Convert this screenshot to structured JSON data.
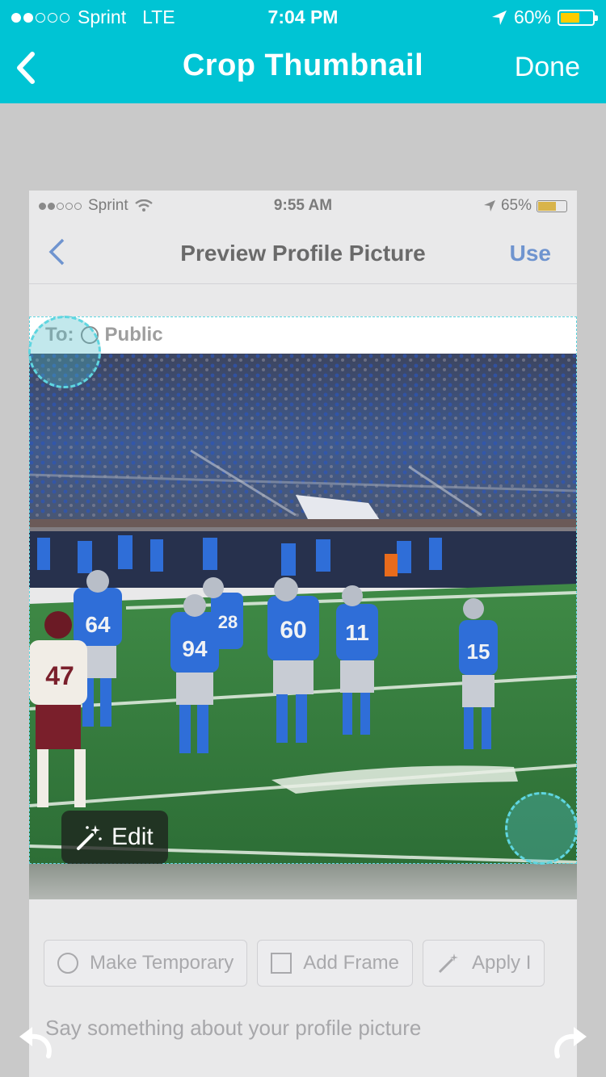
{
  "status_bar": {
    "carrier": "Sprint",
    "network": "LTE",
    "time": "7:04 PM",
    "battery": "60%",
    "battery_level": 0.6,
    "signal_bars": 2
  },
  "nav": {
    "title": "Crop Thumbnail",
    "done_label": "Done"
  },
  "embedded_screenshot": {
    "status": {
      "carrier": "Sprint",
      "time": "9:55 AM",
      "battery": "65%"
    },
    "title": "Preview Profile Picture",
    "use_label": "Use",
    "to_label": "To:",
    "audience": "Public",
    "actions": [
      "Make Temporary",
      "Add Frame",
      "Apply I"
    ],
    "caption_placeholder": "Say something about your profile picture"
  },
  "photo": {
    "jersey_numbers": [
      "64",
      "94",
      "60",
      "11",
      "15",
      "47",
      "28"
    ]
  },
  "edit_button": {
    "label": "Edit"
  },
  "colors": {
    "accent": "#00c4d4",
    "crop_outline": "#5fd6e0",
    "battery_fill": "#ffcc00",
    "lions_blue": "#2f6ed8",
    "field_green": "#2e7a3a"
  },
  "icons": {
    "back": "chevron-left-icon",
    "edit": "magic-wand-icon",
    "undo": "undo-icon",
    "redo": "redo-icon"
  }
}
